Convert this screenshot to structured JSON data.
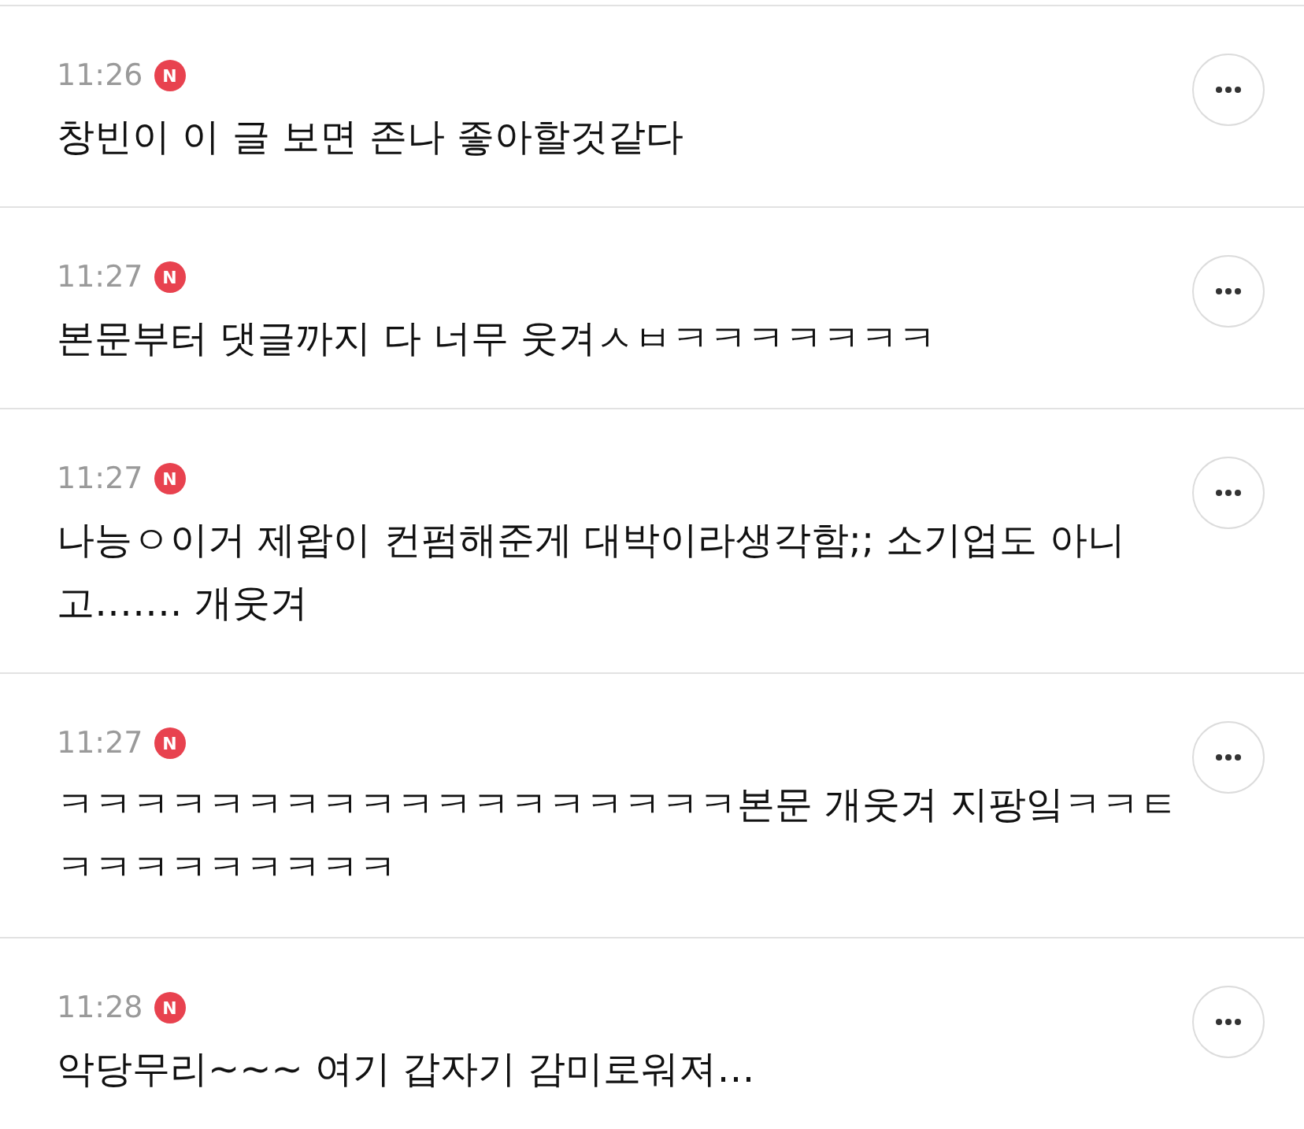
{
  "comments": [
    {
      "time": "11:26",
      "badge": "N",
      "text": "창빈이 이 글 보면 존나 좋아할것같다"
    },
    {
      "time": "11:27",
      "badge": "N",
      "text": "본문부터 댓글까지 다 너무 웃겨ㅅㅂㅋㅋㅋㅋㅋㅋㅋ"
    },
    {
      "time": "11:27",
      "badge": "N",
      "text": "나능ㅇ이거 제왑이 컨펌해준게 대박이라생각함;; 소기업도 아니고……. 개웃겨"
    },
    {
      "time": "11:27",
      "badge": "N",
      "text": "ㅋㅋㅋㅋㅋㅋㅋㅋㅋㅋㅋㅋㅋㅋㅋㅋㅋㅋ본문 개웃겨 지팡잌ㅋㅋㅌㅋㅋㅋㅋㅋㅋㅋㅋㅋ"
    },
    {
      "time": "11:28",
      "badge": "N",
      "text": "악당무리~~~ 여기 갑자기 감미로워져…"
    }
  ]
}
